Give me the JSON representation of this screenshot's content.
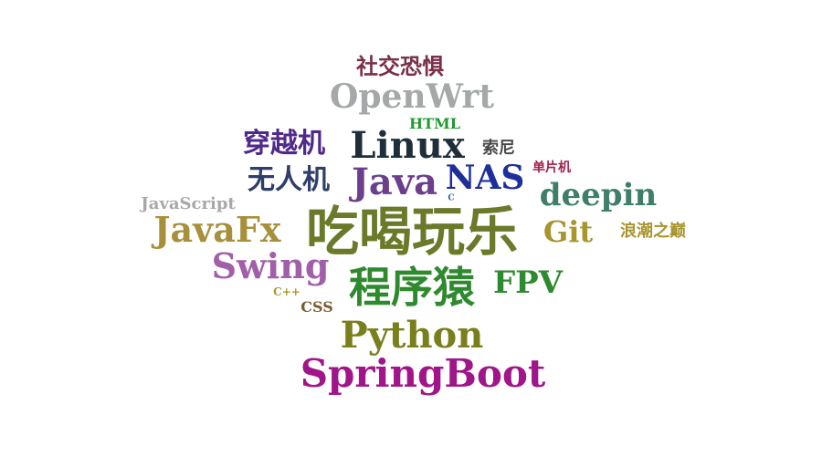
{
  "word_cloud": {
    "words": [
      {
        "text": "吃喝玩乐",
        "color": "#6b7a2a"
      },
      {
        "text": "程序猿",
        "color": "#2f8a2f"
      },
      {
        "text": "SpringBoot",
        "color": "#a0168a"
      },
      {
        "text": "Python",
        "color": "#7a7f1e"
      },
      {
        "text": "Linux",
        "color": "#1f2f3a"
      },
      {
        "text": "OpenWrt",
        "color": "#a5a8a8"
      },
      {
        "text": "Java",
        "color": "#6b3f8c"
      },
      {
        "text": "NAS",
        "color": "#1f2f9a"
      },
      {
        "text": "JavaFx",
        "color": "#a88f3a"
      },
      {
        "text": "Swing",
        "color": "#a05fa8"
      },
      {
        "text": "deepin",
        "color": "#3f7f6a"
      },
      {
        "text": "FPV",
        "color": "#2e8a2e"
      },
      {
        "text": "Git",
        "color": "#a8952e"
      },
      {
        "text": "穿越机",
        "color": "#4f2a8a"
      },
      {
        "text": "无人机",
        "color": "#2f3f6a"
      },
      {
        "text": "社交恐惧",
        "color": "#7a2f4a"
      },
      {
        "text": "HTML",
        "color": "#1f9a2f"
      },
      {
        "text": "索尼",
        "color": "#4a4a4a"
      },
      {
        "text": "单片机",
        "color": "#a01f4a"
      },
      {
        "text": "浪潮之巅",
        "color": "#a8952e"
      },
      {
        "text": "JavaScript",
        "color": "#a8a8a8"
      },
      {
        "text": "C++",
        "color": "#a8952e"
      },
      {
        "text": "CSS",
        "color": "#7a5a2f"
      },
      {
        "text": "C",
        "color": "#2f5f8a"
      }
    ]
  }
}
